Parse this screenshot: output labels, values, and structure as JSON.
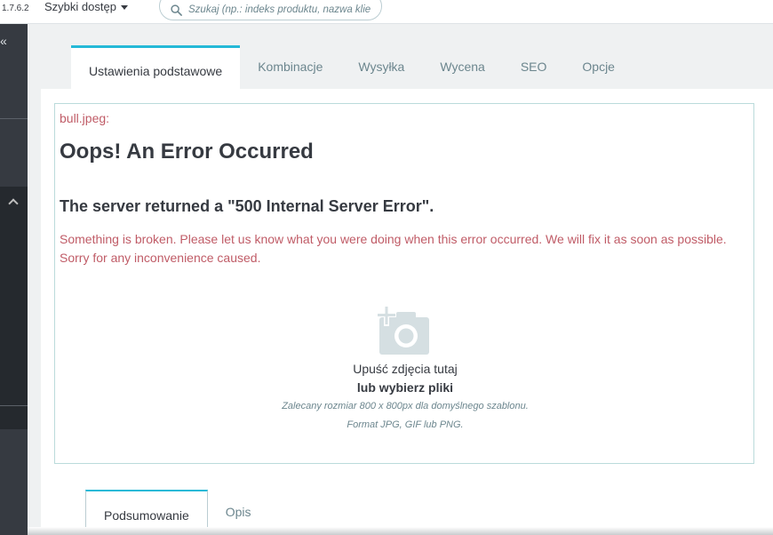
{
  "header": {
    "version": "1.7.6.2",
    "quick_access_label": "Szybki dostęp",
    "search_placeholder": "Szukaj (np.: indeks produktu, nazwa klie"
  },
  "sidebar": {
    "collapse_glyph": "«"
  },
  "tabs": [
    {
      "label": "Ustawienia podstawowe",
      "active": true
    },
    {
      "label": "Kombinacje",
      "active": false
    },
    {
      "label": "Wysyłka",
      "active": false
    },
    {
      "label": "Wycena",
      "active": false
    },
    {
      "label": "SEO",
      "active": false
    },
    {
      "label": "Opcje",
      "active": false
    }
  ],
  "error": {
    "file_label": "bull.jpeg:",
    "title": "Oops! An Error Occurred",
    "subtitle": "The server returned a \"500 Internal Server Error\".",
    "message": "Something is broken. Please let us know what you were doing when this error occurred. We will fix it as soon as possible. Sorry for any inconvenience caused."
  },
  "dropzone": {
    "icon": "add-photo-icon",
    "line1": "Upuść zdjęcia tutaj",
    "line2": "lub wybierz pliki",
    "hint1": "Zalecany rozmiar 800 x 800px dla domyślnego szablonu.",
    "hint2": "Format JPG, GIF lub PNG."
  },
  "bottom_tabs": [
    {
      "label": "Podsumowanie",
      "active": true
    },
    {
      "label": "Opis",
      "active": false
    }
  ],
  "colors": {
    "accent": "#25b9d7",
    "error_text": "#c05c67",
    "sidebar": "#363a41"
  }
}
